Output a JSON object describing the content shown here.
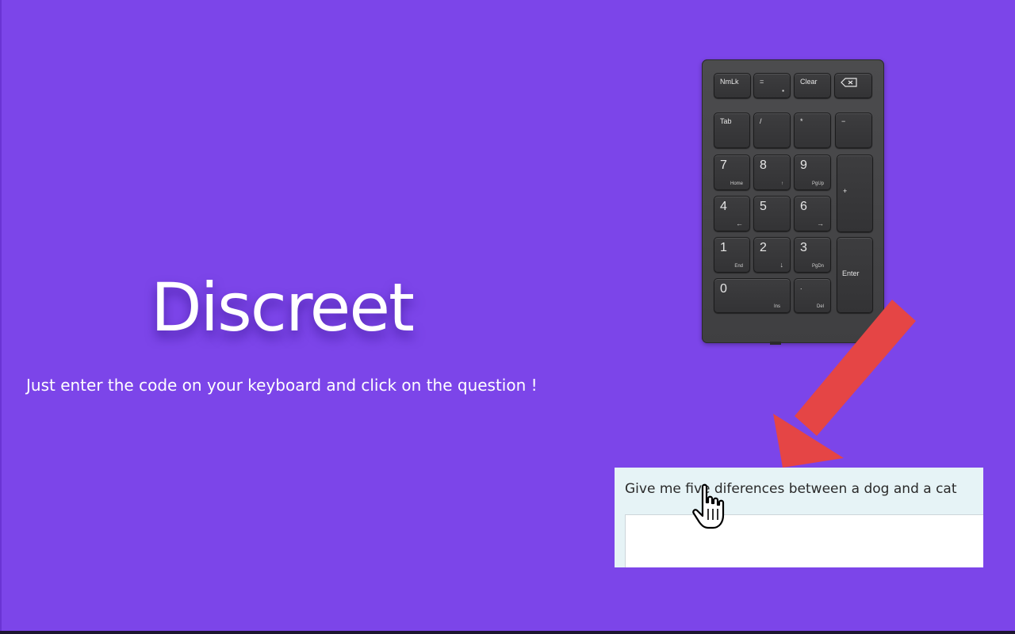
{
  "hero": {
    "title": "Discreet",
    "tagline": "Just enter the code on your keyboard and click on the question !"
  },
  "keypad": {
    "keys": {
      "numlk": "NmLk",
      "equals": "=",
      "clear": "Clear",
      "backspace_icon": "backspace-icon",
      "tab": "Tab",
      "divide": "/",
      "multiply": "*",
      "minus": "−",
      "k7": "7",
      "k7_sub": "Home",
      "k8": "8",
      "k8_sub": "↑",
      "k9": "9",
      "k9_sub": "PgUp",
      "plus": "+",
      "k4": "4",
      "k4_sub": "←",
      "k5": "5",
      "k6": "6",
      "k6_sub": "→",
      "k1": "1",
      "k1_sub": "End",
      "k2": "2",
      "k2_sub": "↓",
      "k3": "3",
      "k3_sub": "PgDn",
      "enter": "Enter",
      "k0": "0",
      "k0_sub": "Ins",
      "dot": ".",
      "dot_sub": "Del"
    }
  },
  "question": {
    "text": "Give me five diferences between a dog and a cat",
    "answer_value": ""
  },
  "colors": {
    "background": "#7c45e9",
    "arrow": "#e54545",
    "card": "#e6f3f6"
  }
}
